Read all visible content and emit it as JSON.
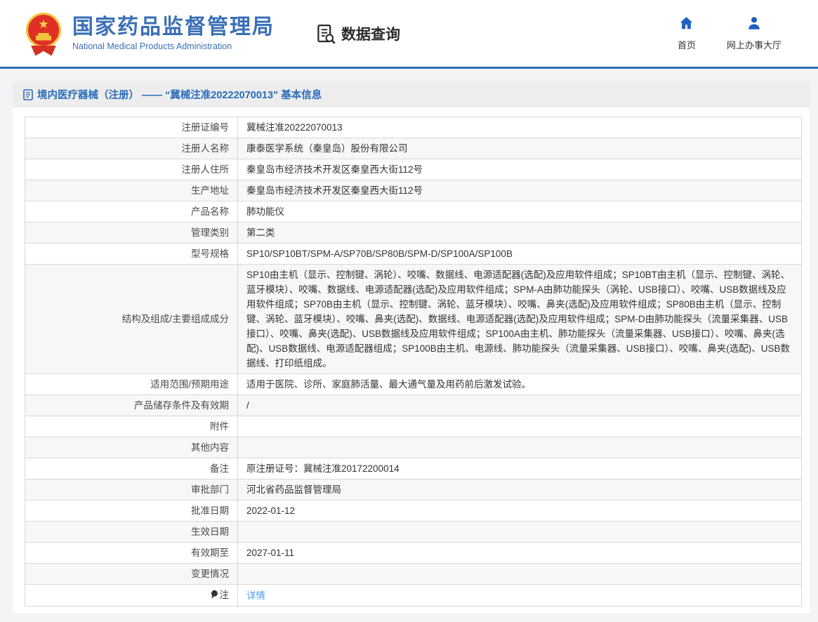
{
  "header": {
    "brand": {
      "name_cn": "国家药品监督管理局",
      "name_en": "National Medical Products Administration"
    },
    "query_label": "数据查询",
    "nav": [
      {
        "label": "首页",
        "icon": "home-icon"
      },
      {
        "label": "网上办事大厅",
        "icon": "user-icon"
      }
    ]
  },
  "page": {
    "title": "境内医疗器械（注册） —— “冀械注准20222070013” 基本信息"
  },
  "table": {
    "rows": [
      {
        "label": "注册证编号",
        "value": "冀械注准20222070013"
      },
      {
        "label": "注册人名称",
        "value": "康泰医学系统（秦皇岛）股份有限公司"
      },
      {
        "label": "注册人住所",
        "value": "秦皇岛市经济技术开发区秦皇西大街112号"
      },
      {
        "label": "生产地址",
        "value": "秦皇岛市经济技术开发区秦皇西大街112号"
      },
      {
        "label": "产品名称",
        "value": "肺功能仪"
      },
      {
        "label": "管理类别",
        "value": "第二类"
      },
      {
        "label": "型号规格",
        "value": "SP10/SP10BT/SPM-A/SP70B/SP80B/SPM-D/SP100A/SP100B"
      },
      {
        "label": "结构及组成/主要组成成分",
        "value": "SP10由主机（显示、控制键、涡轮）、咬嘴、数据线、电源适配器(选配)及应用软件组成；SP10BT由主机（显示、控制键、涡轮、蓝牙模块）、咬嘴、数据线、电源适配器(选配)及应用软件组成；SPM-A由肺功能探头（涡轮、USB接口）、咬嘴、USB数据线及应用软件组成；SP70B由主机（显示、控制键、涡轮、蓝牙模块）、咬嘴、鼻夹(选配)及应用软件组成；SP80B由主机（显示、控制键、涡轮、蓝牙模块）、咬嘴、鼻夹(选配)、数据线、电源适配器(选配)及应用软件组成；SPM-D由肺功能探头（流量采集器、USB接口）、咬嘴、鼻夹(选配)、USB数据线及应用软件组成；SP100A由主机、肺功能探头（流量采集器、USB接口）、咬嘴、鼻夹(选配)、USB数据线、电源适配器组成；SP100B由主机、电源线、肺功能探头（流量采集器、USB接口）、咬嘴、鼻夹(选配)、USB数据线、打印纸组成。"
      },
      {
        "label": "适用范围/预期用途",
        "value": "适用于医院、诊所、家庭肺活量、最大通气量及用药前后激发试验。"
      },
      {
        "label": "产品储存条件及有效期",
        "value": "/"
      },
      {
        "label": "附件",
        "value": ""
      },
      {
        "label": "其他内容",
        "value": ""
      },
      {
        "label": "备注",
        "value": "原注册证号：冀械注准20172200014"
      },
      {
        "label": "审批部门",
        "value": "河北省药品监督管理局"
      },
      {
        "label": "批准日期",
        "value": "2022-01-12"
      },
      {
        "label": "生效日期",
        "value": ""
      },
      {
        "label": "有效期至",
        "value": "2027-01-11"
      },
      {
        "label": "变更情况",
        "value": ""
      },
      {
        "label": "注",
        "value": "详情",
        "icon": "note-icon",
        "link": true
      }
    ]
  },
  "colors": {
    "brand_blue": "#3a6fb5",
    "nav_icon_blue": "#1f5fbf",
    "divider_blue": "#2e6cb4",
    "title_blue": "#2b6cb8",
    "link_blue": "#4a9ef0",
    "row_alt_bg": "#f7f7f7",
    "titlebar_bg": "#ededed",
    "border": "#d9d9d9",
    "emblem_red": "#e03026",
    "emblem_gold": "#f2c23a"
  }
}
